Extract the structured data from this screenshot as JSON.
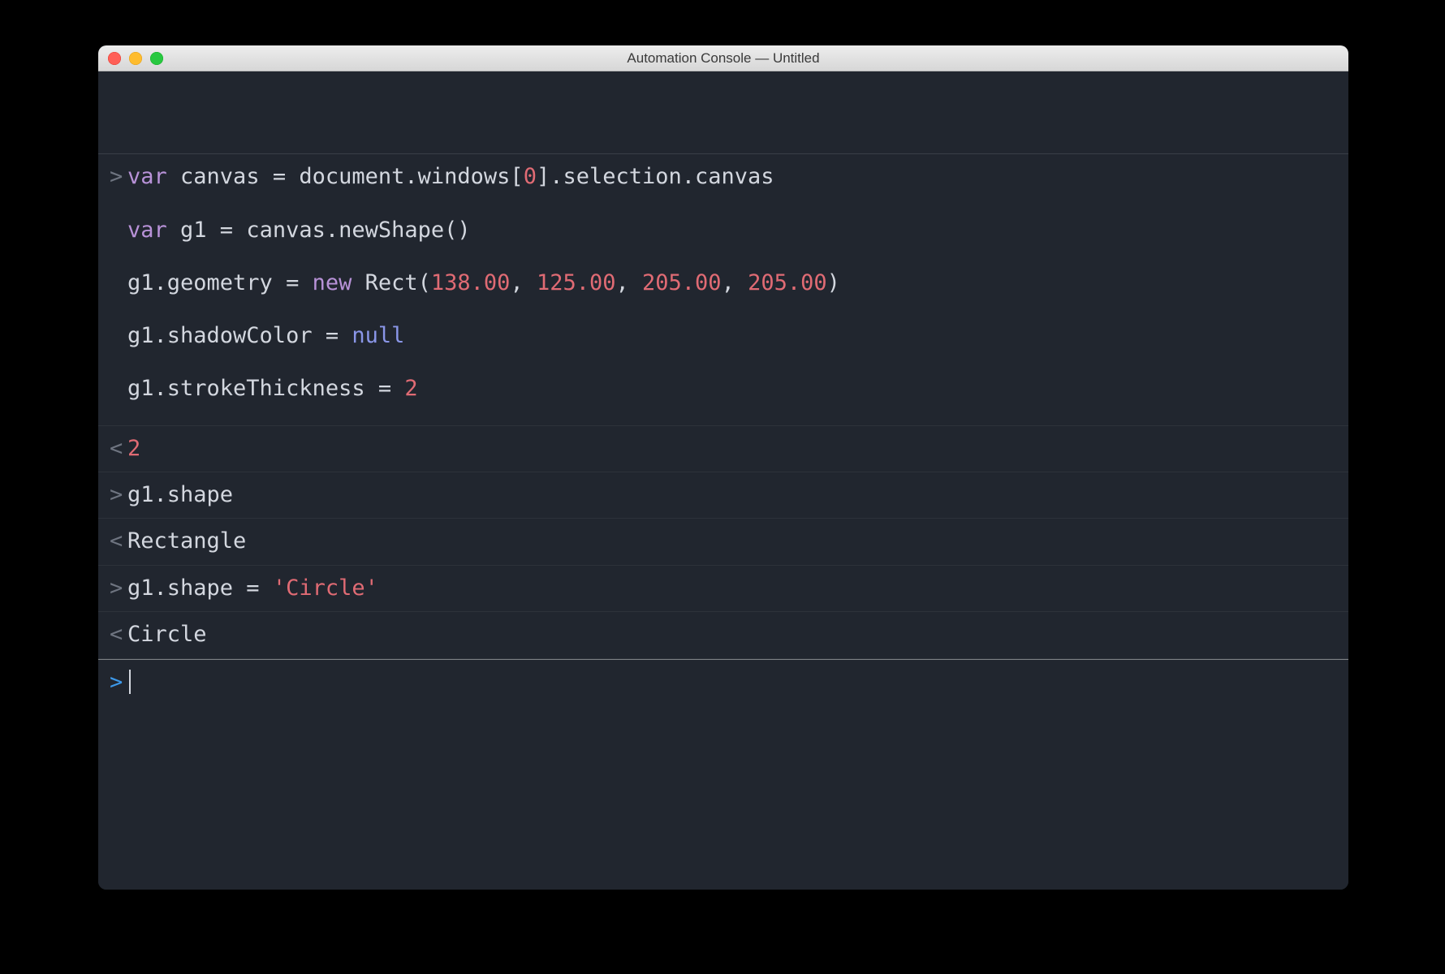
{
  "window": {
    "title": "Automation Console — Untitled"
  },
  "colors": {
    "bg": "#21262f",
    "keyword": "#b892d8",
    "number": "#e06b74",
    "null": "#8a96e8",
    "text": "#d3d7df",
    "prompt_active": "#3d99ea"
  },
  "entries": [
    {
      "kind": "input",
      "lines": [
        [
          {
            "t": "var",
            "c": "kw"
          },
          {
            "t": " canvas = document.windows[",
            "c": "def"
          },
          {
            "t": "0",
            "c": "num"
          },
          {
            "t": "].selection.canvas",
            "c": "def"
          }
        ],
        [
          {
            "t": "var",
            "c": "kw"
          },
          {
            "t": " g1 = canvas.newShape()",
            "c": "def"
          }
        ],
        [
          {
            "t": "g1.geometry = ",
            "c": "def"
          },
          {
            "t": "new",
            "c": "kw"
          },
          {
            "t": " Rect(",
            "c": "def"
          },
          {
            "t": "138.00",
            "c": "num"
          },
          {
            "t": ", ",
            "c": "def"
          },
          {
            "t": "125.00",
            "c": "num"
          },
          {
            "t": ", ",
            "c": "def"
          },
          {
            "t": "205.00",
            "c": "num"
          },
          {
            "t": ", ",
            "c": "def"
          },
          {
            "t": "205.00",
            "c": "num"
          },
          {
            "t": ")",
            "c": "def"
          }
        ],
        [
          {
            "t": "g1.shadowColor = ",
            "c": "def"
          },
          {
            "t": "null",
            "c": "null"
          }
        ],
        [
          {
            "t": "g1.strokeThickness = ",
            "c": "def"
          },
          {
            "t": "2",
            "c": "num"
          }
        ]
      ]
    },
    {
      "kind": "output",
      "lines": [
        [
          {
            "t": "2",
            "c": "num"
          }
        ]
      ]
    },
    {
      "kind": "input",
      "lines": [
        [
          {
            "t": "g1.shape",
            "c": "def"
          }
        ]
      ]
    },
    {
      "kind": "output",
      "lines": [
        [
          {
            "t": "Rectangle",
            "c": "def"
          }
        ]
      ]
    },
    {
      "kind": "input",
      "lines": [
        [
          {
            "t": "g1.shape = ",
            "c": "def"
          },
          {
            "t": "'Circle'",
            "c": "str"
          }
        ]
      ]
    },
    {
      "kind": "output",
      "lines": [
        [
          {
            "t": "Circle",
            "c": "def"
          }
        ]
      ]
    },
    {
      "kind": "prompt",
      "lines": [
        []
      ]
    }
  ]
}
